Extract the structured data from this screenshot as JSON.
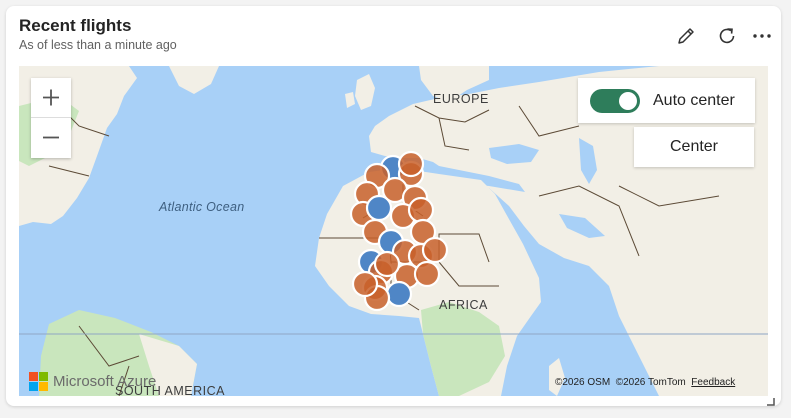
{
  "card": {
    "title": "Recent flights",
    "subtitle": "As of less than a minute ago",
    "actions": [
      "pencil-icon",
      "refresh-icon",
      "more-icon"
    ]
  },
  "map": {
    "controls": {
      "zoom_in": "+",
      "zoom_out": "−",
      "auto_center_label": "Auto center",
      "auto_center_on": true,
      "center_label": "Center"
    },
    "labels": {
      "europe": "EUROPE",
      "atlantic": "Atlantic Ocean",
      "africa": "AFRICA",
      "south_america": "SOUTH AMERICA"
    },
    "brand": "Microsoft Azure",
    "attribution": {
      "osm": "©2026 OSM",
      "tomtom": "©2026 TomTom",
      "feedback": "Feedback"
    },
    "colors": {
      "water": "#a8d0f7",
      "land": "#f2efe6",
      "forest": "#c9e6bd",
      "marker_orange": "#c8602a",
      "marker_blue": "#4f86c6",
      "toggle_on": "#2e7d5b"
    }
  }
}
